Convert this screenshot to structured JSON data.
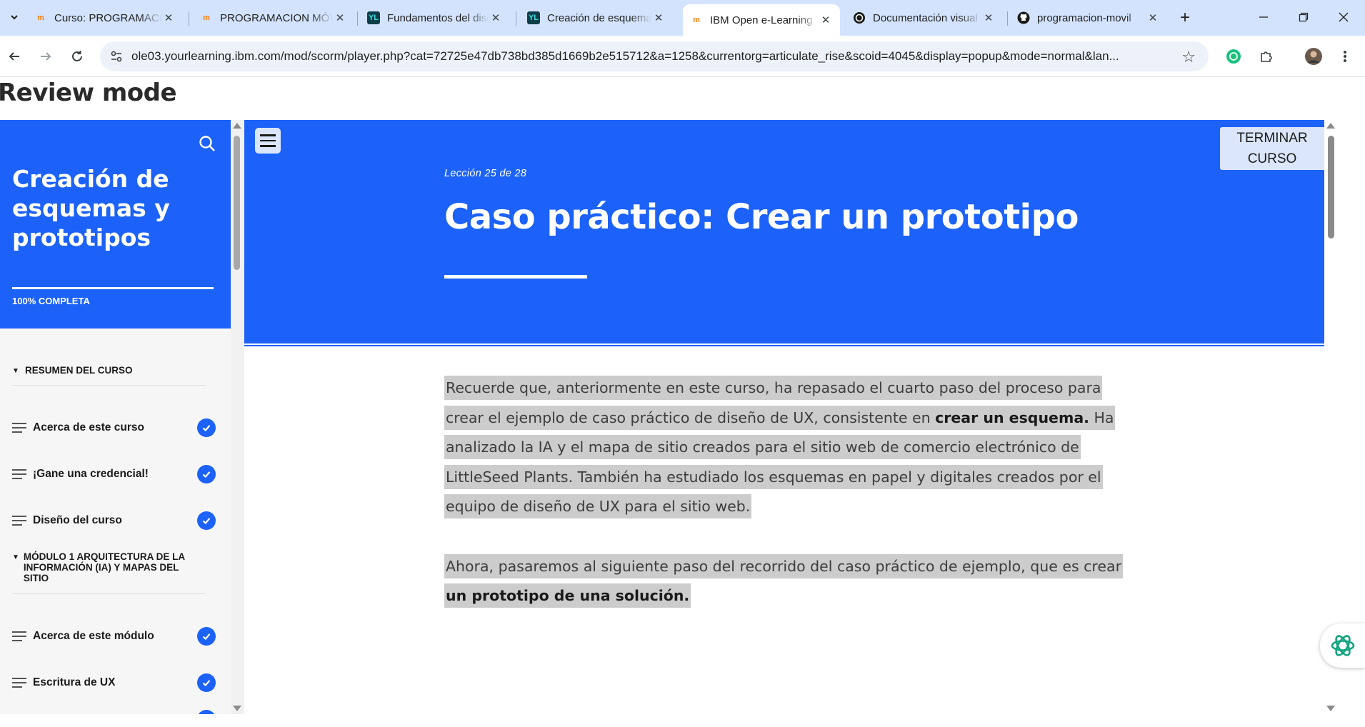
{
  "browser": {
    "tabs": [
      {
        "label": "Curso: PROGRAMACIÓN",
        "favicon": "moodle-icon",
        "active": false
      },
      {
        "label": "PROGRAMACION MÓVIL",
        "favicon": "moodle-icon",
        "active": false
      },
      {
        "label": "Fundamentos del diseño",
        "favicon": "yourlearning-icon",
        "active": false
      },
      {
        "label": "Creación de esquemas",
        "favicon": "yourlearning-icon",
        "active": false
      },
      {
        "label": "IBM Open e-Learning",
        "favicon": "moodle-icon",
        "active": true
      },
      {
        "label": "Documentación visual",
        "favicon": "openai-icon",
        "active": false
      },
      {
        "label": "programacion-movil",
        "favicon": "github-icon",
        "active": false
      }
    ],
    "url": "ole03.yourlearning.ibm.com/mod/scorm/player.php?cat=72725e47db738bd385d1669b2e515712&a=1258&currentorg=articulate_rise&scoid=4045&display=popup&mode=normal&lan..."
  },
  "page": {
    "review_mode": "Review mode"
  },
  "sidebar": {
    "course_title": "Creación de esquemas y prototipos",
    "progress_label": "100% COMPLETA",
    "progress_fraction": 1.0,
    "sections": [
      {
        "title": "RESUMEN DEL CURSO",
        "items": [
          "Acerca de este curso",
          "¡Gane una credencial!",
          "Diseño del curso"
        ]
      },
      {
        "title": "MÓDULO 1 ARQUITECTURA DE LA INFORMACIÓN (IA) Y MAPAS DEL SITIO",
        "items": [
          "Acerca de este módulo",
          "Escritura de UX"
        ]
      }
    ]
  },
  "main": {
    "finish_button": "TERMINAR CURSO",
    "lesson_number": "Lección 25 de 28",
    "lesson_title": "Caso práctico: Crear un prototipo",
    "paragraph1": {
      "part1": "Recuerde que, anteriormente en este curso, ha repasado el cuarto paso del proceso para crear el ejemplo de caso práctico de diseño de UX, consistente en ",
      "bold": "crear un esquema.",
      "part2": " Ha analizado la IA y el mapa de sitio creados para el sitio web de comercio electrónico de LittleSeed Plants. También ha estudiado los esquemas en papel y digitales creados por el equipo de diseño de UX para el sitio web. "
    },
    "paragraph2": {
      "part1": "Ahora, pasaremos al siguiente paso del recorrido del caso práctico de ejemplo, que es crear ",
      "bold": "un prototipo de una solución."
    }
  },
  "colors": {
    "accent": "#1c62f8",
    "highlight": "#cccccc",
    "tabbar": "#d3e3fd"
  }
}
